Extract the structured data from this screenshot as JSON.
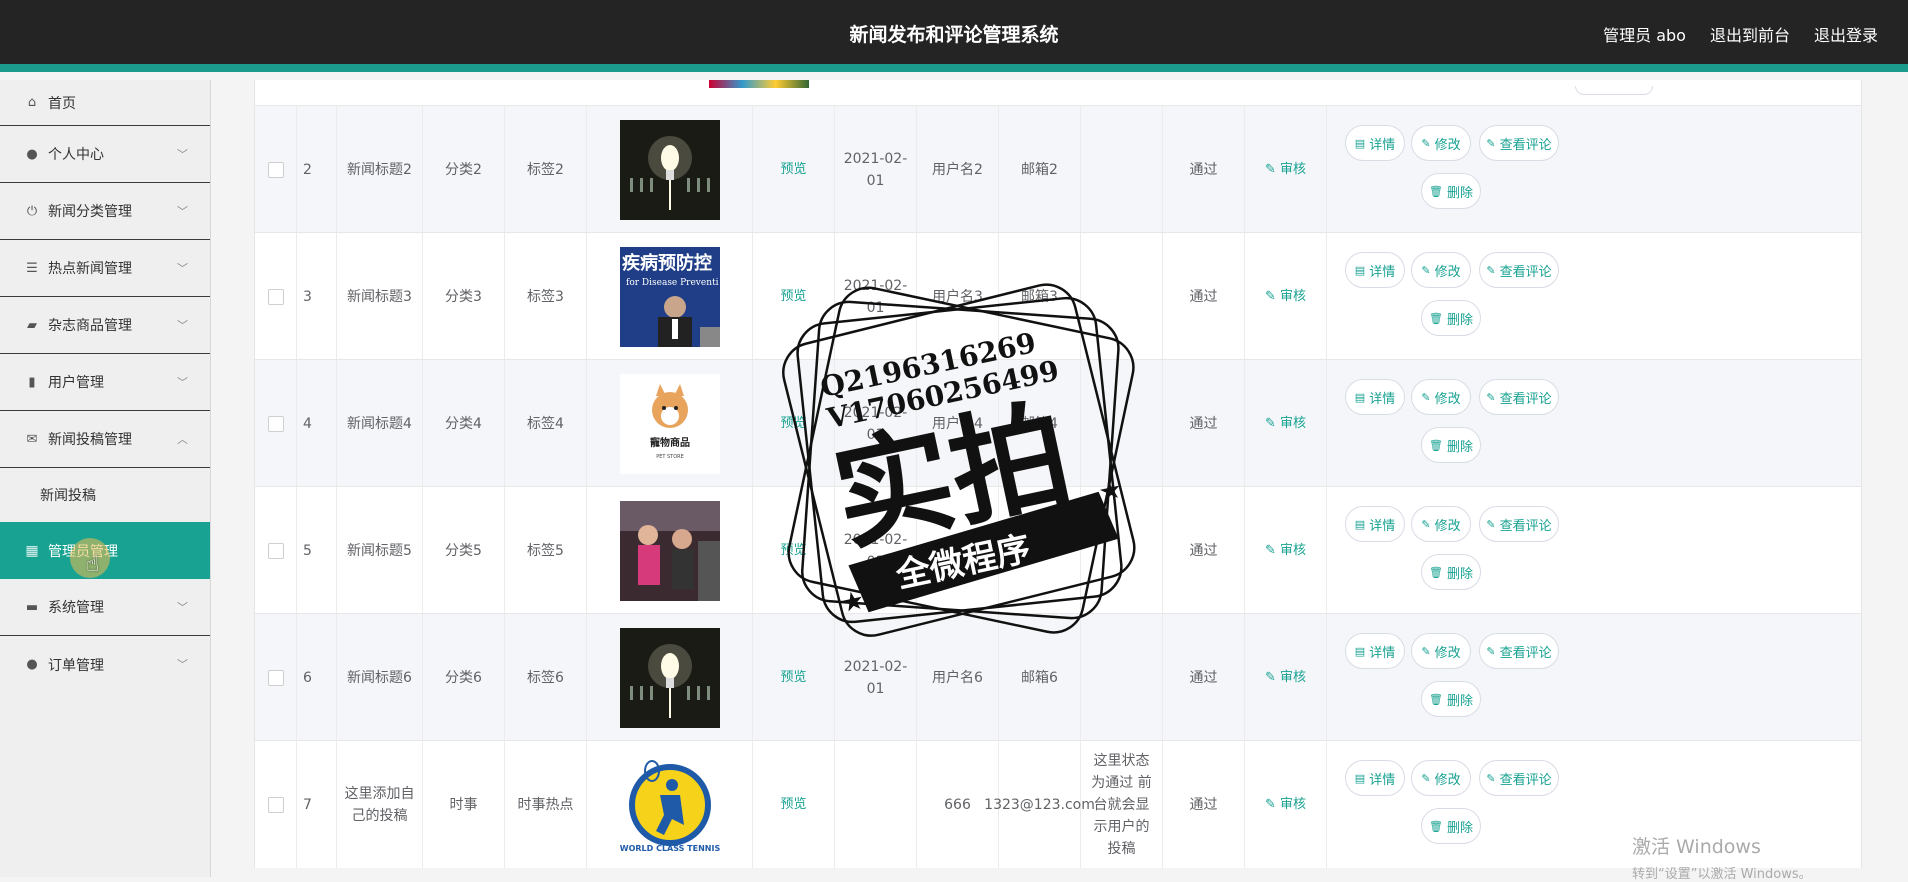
{
  "header": {
    "title": "新闻发布和评论管理系统",
    "admin_label": "管理员 abo",
    "exit_front": "退出到前台",
    "logout": "退出登录"
  },
  "sidebar": {
    "items": [
      {
        "label": "首页",
        "icon": "home-icon"
      },
      {
        "label": "个人中心",
        "icon": "user-icon"
      },
      {
        "label": "新闻分类管理",
        "icon": "power-icon"
      },
      {
        "label": "热点新闻管理",
        "icon": "list-icon"
      },
      {
        "label": "杂志商品管理",
        "icon": "chat-icon"
      },
      {
        "label": "用户管理",
        "icon": "bars-icon"
      },
      {
        "label": "新闻投稿管理",
        "icon": "mail-icon"
      }
    ],
    "sub_item": "新闻投稿",
    "active_item": "管理员管理",
    "after_items": [
      {
        "label": "系统管理",
        "icon": "briefcase-icon"
      },
      {
        "label": "订单管理",
        "icon": "person-icon"
      }
    ]
  },
  "table": {
    "rows": [
      {
        "index": "2",
        "title": "新闻标题2",
        "category": "分类2",
        "tag": "标签2",
        "preview": "预览",
        "date": "2021-02-01",
        "user": "用户名2",
        "email": "邮箱2",
        "remark": "",
        "status": "通过",
        "audit": "审核",
        "image": "bulb"
      },
      {
        "index": "3",
        "title": "新闻标题3",
        "category": "分类3",
        "tag": "标签3",
        "preview": "预览",
        "date": "2021-02-01",
        "user": "用户名3",
        "email": "邮箱3",
        "remark": "",
        "status": "通过",
        "audit": "审核",
        "image": "cdc"
      },
      {
        "index": "4",
        "title": "新闻标题4",
        "category": "分类4",
        "tag": "标签4",
        "preview": "预览",
        "date": "2021-02-01",
        "user": "用户名4",
        "email": "邮箱4",
        "remark": "",
        "status": "通过",
        "audit": "审核",
        "image": "pet"
      },
      {
        "index": "5",
        "title": "新闻标题5",
        "category": "分类5",
        "tag": "标签5",
        "preview": "预览",
        "date": "2021-02-01",
        "user": "用户名5",
        "email": "邮箱5",
        "remark": "",
        "status": "通过",
        "audit": "审核",
        "image": "gym"
      },
      {
        "index": "6",
        "title": "新闻标题6",
        "category": "分类6",
        "tag": "标签6",
        "preview": "预览",
        "date": "2021-02-01",
        "user": "用户名6",
        "email": "邮箱6",
        "remark": "",
        "status": "通过",
        "audit": "审核",
        "image": "bulb"
      },
      {
        "index": "7",
        "title": "这里添加自己的投稿",
        "category": "时事",
        "tag": "时事热点",
        "preview": "预览",
        "date": "",
        "user": "666",
        "email": "1323@123.com",
        "remark": "这里状态为通过 前台就会显示用户的投稿",
        "status": "通过",
        "audit": "审核",
        "image": "tennis"
      }
    ],
    "buttons": {
      "detail": "详情",
      "edit": "修改",
      "comments": "查看评论",
      "delete": "删除"
    }
  },
  "images": {
    "cdc_text": "疾病预防控",
    "cdc_sub": "for Disease Preventi",
    "pet_text": "寵物商品",
    "pet_sub": "PET STORE",
    "tennis_text": "WORLD CLASS TENNIS"
  },
  "watermark": {
    "line1": "Q2196316269",
    "line2": "V17060256499",
    "main": "实拍",
    "banner": "全微程序"
  },
  "windows": {
    "line1": "激活 Windows",
    "line2": "转到“设置”以激活 Windows。"
  },
  "colors": {
    "accent": "#18a292",
    "header_bg": "#242424"
  }
}
